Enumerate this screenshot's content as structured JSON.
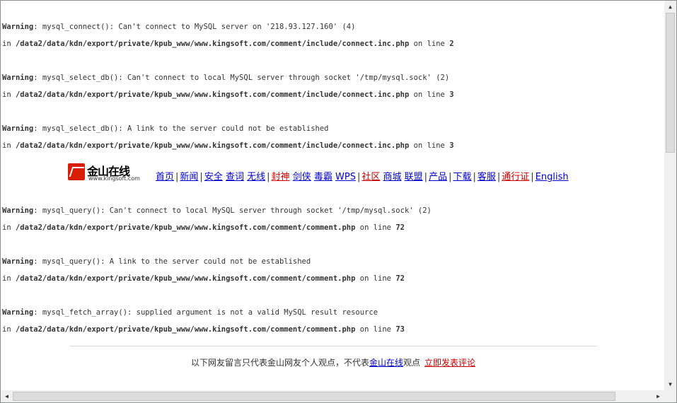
{
  "warnings": [
    {
      "label": "Warning",
      "message": ": mysql_connect(): Can't connect to MySQL server on '218.93.127.160' (4)",
      "in": "in",
      "path": "/data2/data/kdn/export/private/kpub_www/www.kingsoft.com/comment/include/connect.inc.php",
      "on_line": "on line",
      "line": "2"
    },
    {
      "label": "Warning",
      "message": ": mysql_select_db(): Can't connect to local MySQL server through socket '/tmp/mysql.sock' (2)",
      "in": "in",
      "path": "/data2/data/kdn/export/private/kpub_www/www.kingsoft.com/comment/include/connect.inc.php",
      "on_line": "on line",
      "line": "3"
    },
    {
      "label": "Warning",
      "message": ": mysql_select_db(): A link to the server could not be established",
      "in": "in",
      "path": "/data2/data/kdn/export/private/kpub_www/www.kingsoft.com/comment/include/connect.inc.php",
      "on_line": "on line",
      "line": "3"
    },
    {
      "label": "Warning",
      "message": ": mysql_query(): Can't connect to local MySQL server through socket '/tmp/mysql.sock' (2)",
      "in": "in",
      "path": "/data2/data/kdn/export/private/kpub_www/www.kingsoft.com/comment/comment.php",
      "on_line": "on line",
      "line": "72"
    },
    {
      "label": "Warning",
      "message": ": mysql_query(): A link to the server could not be established",
      "in": "in",
      "path": "/data2/data/kdn/export/private/kpub_www/www.kingsoft.com/comment/comment.php",
      "on_line": "on line",
      "line": "72"
    },
    {
      "label": "Warning",
      "message": ": mysql_fetch_array(): supplied argument is not a valid MySQL result resource",
      "in": "in",
      "path": "/data2/data/kdn/export/private/kpub_www/www.kingsoft.com/comment/comment.php",
      "on_line": "on line",
      "line": "73"
    }
  ],
  "logo": {
    "text": "金山在线",
    "url": "www.kingsoft.com"
  },
  "nav": {
    "home": "首页",
    "news": "新闻",
    "security": "安全",
    "query": "查词",
    "wireless": "无线",
    "fengshen": "封神",
    "jianxia": "剑侠",
    "dubai": "毒霸",
    "wps": "WPS",
    "community": "社区",
    "mall": "商城",
    "union": "联盟",
    "products": "产品",
    "download": "下载",
    "service": "客服",
    "passport": "通行证",
    "english": "English"
  },
  "footer": {
    "text": "以下网友留言只代表金山网友个人观点，不代表",
    "site_link": "金山在线",
    "text_after": "观点",
    "comment_link": "立即发表评论"
  },
  "colors": {
    "link": "#0000cc",
    "red_link": "#cc0000"
  }
}
